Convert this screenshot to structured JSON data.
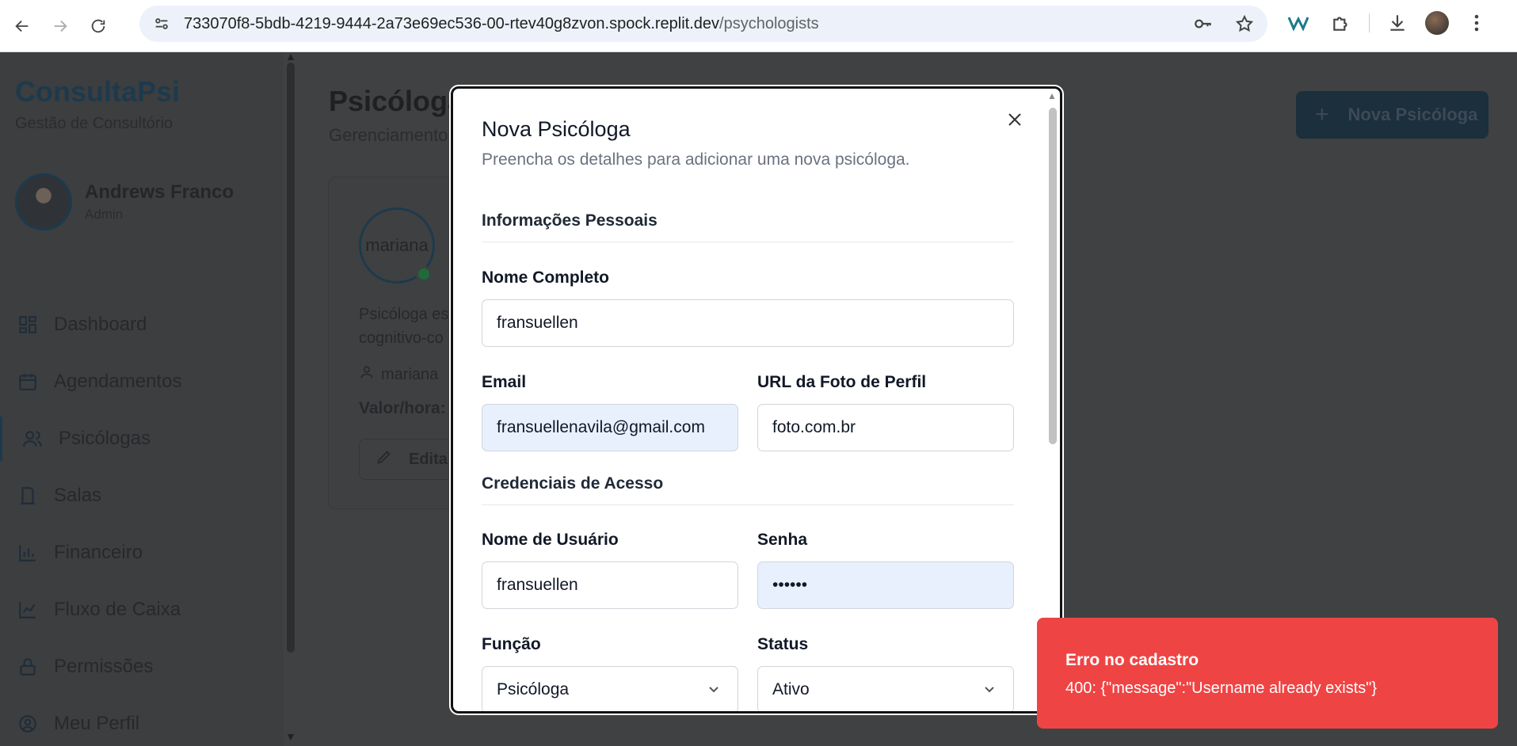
{
  "browser": {
    "url_host": "733070f8-5bdb-4219-9444-2a73e69ec536-00-rtev40g8zvon.spock.replit.dev",
    "url_path": "/psychologists"
  },
  "sidebar": {
    "brand": "ConsultaPsi",
    "brand_sub": "Gestão de Consultório",
    "user_name": "Andrews Franco",
    "user_role": "Admin",
    "items": [
      {
        "label": "Dashboard",
        "icon": "grid-icon"
      },
      {
        "label": "Agendamentos",
        "icon": "calendar-icon"
      },
      {
        "label": "Psicólogas",
        "icon": "users-icon"
      },
      {
        "label": "Salas",
        "icon": "door-icon"
      },
      {
        "label": "Financeiro",
        "icon": "bar-chart-icon"
      },
      {
        "label": "Fluxo de Caixa",
        "icon": "line-chart-icon"
      },
      {
        "label": "Permissões",
        "icon": "lock-icon"
      },
      {
        "label": "Meu Perfil",
        "icon": "user-circle-icon"
      }
    ]
  },
  "main": {
    "title": "Psicóloga",
    "subtitle": "Gerenciamento",
    "new_button": "Nova Psicóloga",
    "card": {
      "avatar_alt": "mariana",
      "desc": "Psicóloga es cognitivo-co",
      "username": "mariana",
      "valor_label": "Valor/hora:",
      "edit_label": "Edita"
    }
  },
  "modal": {
    "title": "Nova Psicóloga",
    "description": "Preencha os detalhes para adicionar uma nova psicóloga.",
    "section_personal": "Informações Pessoais",
    "section_credentials": "Credenciais de Acesso",
    "fields": {
      "full_name": {
        "label": "Nome Completo",
        "value": "fransuellen"
      },
      "email": {
        "label": "Email",
        "value": "fransuellenavila@gmail.com"
      },
      "photo_url": {
        "label": "URL da Foto de Perfil",
        "value": "foto.com.br"
      },
      "username": {
        "label": "Nome de Usuário",
        "value": "fransuellen"
      },
      "password": {
        "label": "Senha",
        "value": "••••••"
      },
      "role": {
        "label": "Função",
        "value": "Psicóloga"
      },
      "status": {
        "label": "Status",
        "value": "Ativo"
      }
    }
  },
  "toast": {
    "title": "Erro no cadastro",
    "message": "400: {\"message\":\"Username already exists\"}"
  },
  "colors": {
    "toast_bg": "#ef4444",
    "brand": "#1d3a4d",
    "autofill_bg": "#e8f0fe"
  }
}
